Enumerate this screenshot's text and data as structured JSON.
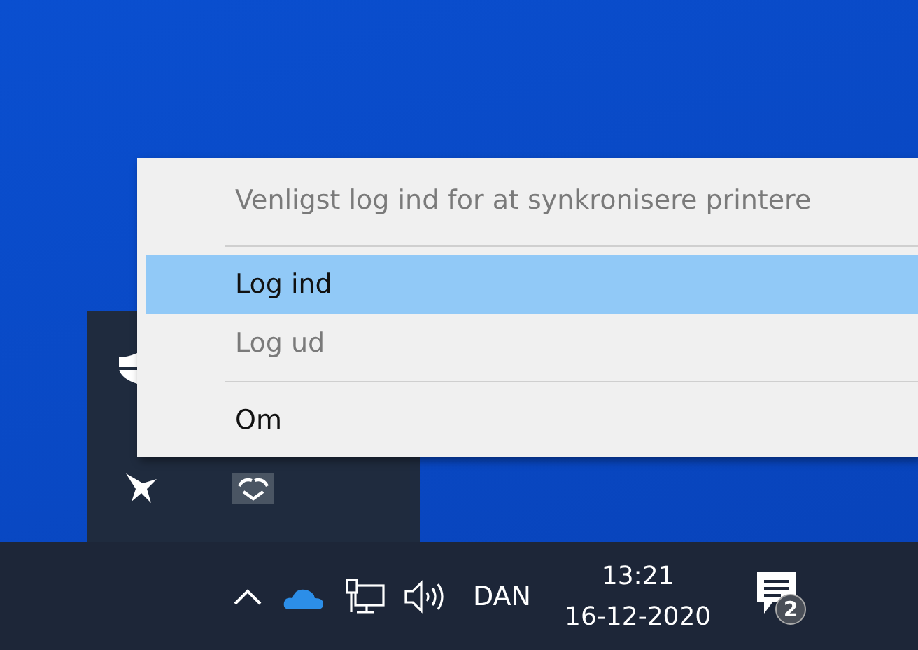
{
  "menu": {
    "items": [
      {
        "kind": "header",
        "label": "Venligst log ind for at synkronisere printere",
        "disabled": true,
        "selected": false
      },
      {
        "kind": "separator"
      },
      {
        "kind": "item",
        "label": "Log ind",
        "disabled": false,
        "selected": true
      },
      {
        "kind": "item",
        "label": "Log ud",
        "disabled": true,
        "selected": false
      },
      {
        "kind": "separator"
      },
      {
        "kind": "item",
        "label": "Om",
        "disabled": false,
        "selected": false
      }
    ]
  },
  "tray": {
    "language": "DAN",
    "time": "13:21",
    "date": "16-12-2020",
    "notification_count": "2"
  }
}
